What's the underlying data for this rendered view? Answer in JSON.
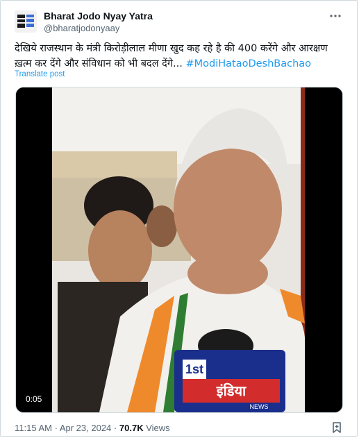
{
  "tweet": {
    "author_name": "Bharat Jodo Nyay Yatra",
    "author_handle": "@bharatjodonyaay",
    "more_icon": "more-dots-icon",
    "text": "देखिये राजस्थान के मंत्री किरोड़ीलाल मीणा खुद कह रहे है की 400 करेंगे और आरक्षण ख़त्म कर देंगे और संविधान को भी बदल देंगे...",
    "hashtag": "#ModiHataoDeshBachao",
    "translate_label": "Translate post",
    "video": {
      "duration": "0:05",
      "mic_brand_top": "1st",
      "mic_brand_main": "इंडिया",
      "mic_brand_sub": "NEWS"
    },
    "time": "11:15 AM",
    "separator": "·",
    "date": "Apr 23, 2024",
    "views_count": "70.7K",
    "views_label": "Views",
    "bookmark_icon": "bookmark-icon"
  }
}
